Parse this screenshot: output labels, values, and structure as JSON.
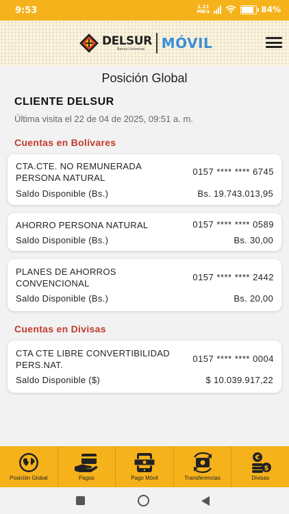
{
  "status": {
    "time": "9:53",
    "net_speed": "1.11",
    "net_unit": "MB/s",
    "battery": "84%"
  },
  "header": {
    "brand": "DELSUR",
    "brand_sub": "Banco Universal",
    "app": "MÓVIL"
  },
  "page": {
    "title": "Posición Global"
  },
  "client": {
    "name": "CLIENTE DELSUR",
    "last_visit": "Última visita el 22 de 04 de 2025, 09:51 a. m."
  },
  "sections": {
    "bolivares": "Cuentas en Bolívares",
    "divisas": "Cuentas en Divisas"
  },
  "accounts": [
    {
      "name": "CTA.CTE. NO REMUNERADA PERSONA NATURAL",
      "number": "0157 **** **** 6745",
      "label": "Saldo Disponible (Bs.)",
      "amount": "Bs. 19.743.013,95"
    },
    {
      "name": "AHORRO PERSONA NATURAL",
      "number": "0157 **** **** 0589",
      "label": "Saldo Disponible (Bs.)",
      "amount": "Bs. 30,00"
    },
    {
      "name": "PLANES DE AHORROS CONVENCIONAL",
      "number": "0157 **** **** 2442",
      "label": "Saldo Disponible (Bs.)",
      "amount": "Bs. 20,00"
    },
    {
      "name": "CTA CTE LIBRE CONVERTIBILIDAD PERS.NAT.",
      "number": "0157 **** **** 0004",
      "label": "Saldo Disponible ($)",
      "amount": "$ 10.039.917,22"
    }
  ],
  "tabs": [
    {
      "label": "Posición Global",
      "icon": "globe-icon"
    },
    {
      "label": "Pagos",
      "icon": "card-hand-icon"
    },
    {
      "label": "Pago Móvil",
      "icon": "mobile-payment-icon"
    },
    {
      "label": "Transferencias",
      "icon": "transfer-icon"
    },
    {
      "label": "Divisas",
      "icon": "currency-coins-icon"
    }
  ],
  "colors": {
    "accent": "#f6b21b",
    "section": "#c0392b",
    "brand_blue": "#3a8fd9"
  }
}
